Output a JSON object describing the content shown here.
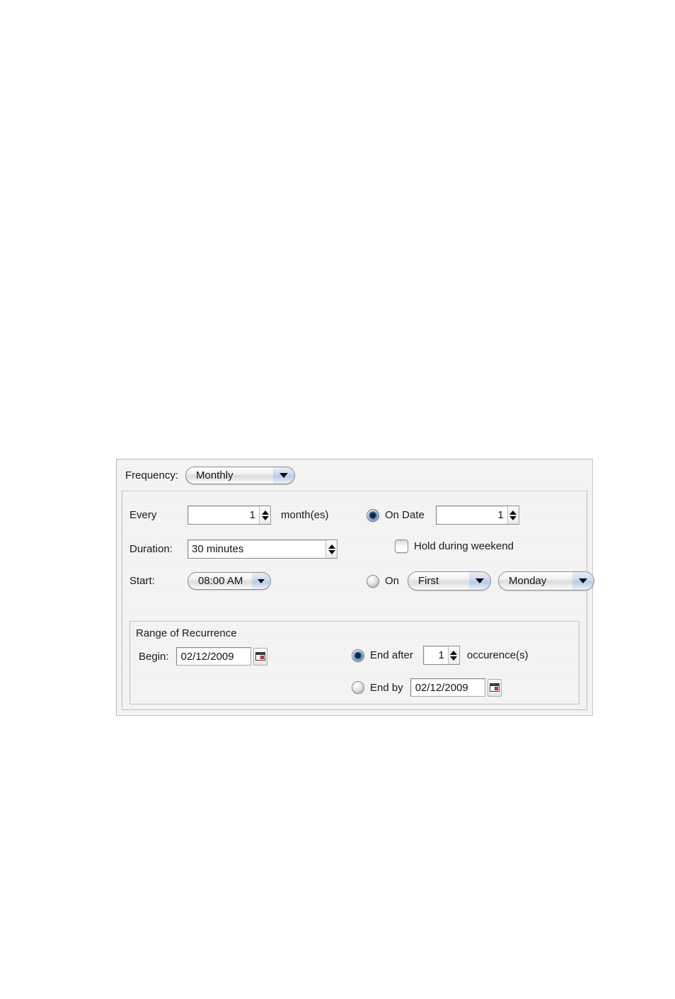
{
  "dialog": {
    "frequency": {
      "label": "Frequency:",
      "value": "Monthly",
      "options": [
        "Monthly"
      ]
    },
    "every": {
      "label": "Every",
      "value": "1",
      "unit_label": "month(es)"
    },
    "on_date": {
      "radio_label": "On Date",
      "selected": true,
      "value": "1"
    },
    "duration": {
      "label": "Duration:",
      "value": "30 minutes"
    },
    "hold_weekend": {
      "label": "Hold during weekend",
      "checked": false
    },
    "start": {
      "label": "Start:",
      "value": "08:00 AM"
    },
    "on_weekday": {
      "radio_label": "On",
      "selected": false,
      "ordinal": "First",
      "weekday": "Monday"
    },
    "range": {
      "title": "Range of Recurrence",
      "begin": {
        "label": "Begin:",
        "value": "02/12/2009",
        "picker_icon": "calendar-icon"
      },
      "end_after": {
        "radio_label": "End after",
        "selected": true,
        "value": "1",
        "unit_label": "occurence(s)"
      },
      "end_by": {
        "radio_label": "End by",
        "selected": false,
        "value": "02/12/2009",
        "picker_icon": "calendar-icon"
      }
    }
  },
  "colors": {
    "panel_bg": "#f2f2f2",
    "border": "#b4b4b4",
    "text": "#1a1a1a",
    "radio_selected": "#14243f",
    "combo_arrow_tint": "#b9cbe6",
    "calendar_accent": "#d33a3a"
  }
}
